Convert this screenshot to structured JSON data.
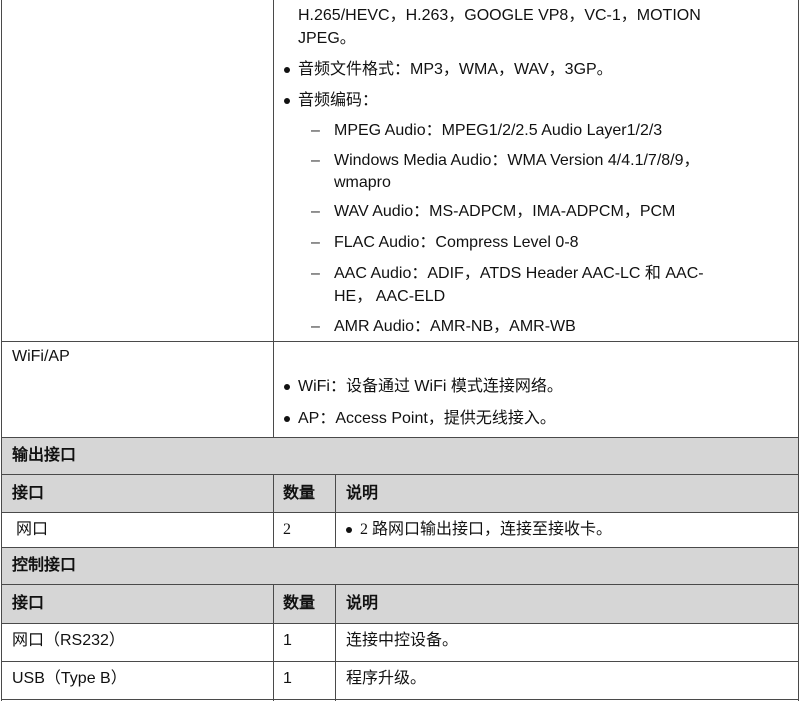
{
  "codec_cont": [
    "H.265/HEVC，H.263，GOOGLE VP8，VC-1，MOTION",
    "JPEG。"
  ],
  "audio_format": "音频文件格式：MP3，WMA，WAV，3GP。",
  "audio_codec_title": "音频编码：",
  "audio_codecs": [
    [
      "MPEG Audio：MPEG1/2/2.5 Audio Layer1/2/3"
    ],
    [
      "Windows Media Audio：WMA Version 4/4.1/7/8/9，",
      "wmapro"
    ],
    [
      "WAV Audio：MS-ADPCM，IMA-ADPCM，PCM"
    ],
    [
      "FLAC Audio：Compress Level 0-8"
    ],
    [
      "AAC Audio：ADIF，ATDS Header AAC-LC 和 AAC-",
      "HE， AAC-ELD"
    ],
    [
      "AMR Audio：AMR-NB，AMR-WB"
    ]
  ],
  "dash": "–",
  "wifi_label": "WiFi/AP",
  "wifi_items": [
    "WiFi：设备通过 WiFi 模式连接网络。",
    "AP：Access Point，提供无线接入。"
  ],
  "output_section": "输出接口",
  "headers": {
    "port": "接口",
    "qty": "数量",
    "desc": "说明"
  },
  "output_row": {
    "port": "网口",
    "qty": "2",
    "desc": "2 路网口输出接口，连接至接收卡。"
  },
  "control_section": "控制接口",
  "control_rows": [
    {
      "port": "网口（RS232）",
      "qty": "1",
      "desc": "连接中控设备。"
    },
    {
      "port": "USB（Type B）",
      "qty": "1",
      "desc": "程序升级。"
    }
  ]
}
